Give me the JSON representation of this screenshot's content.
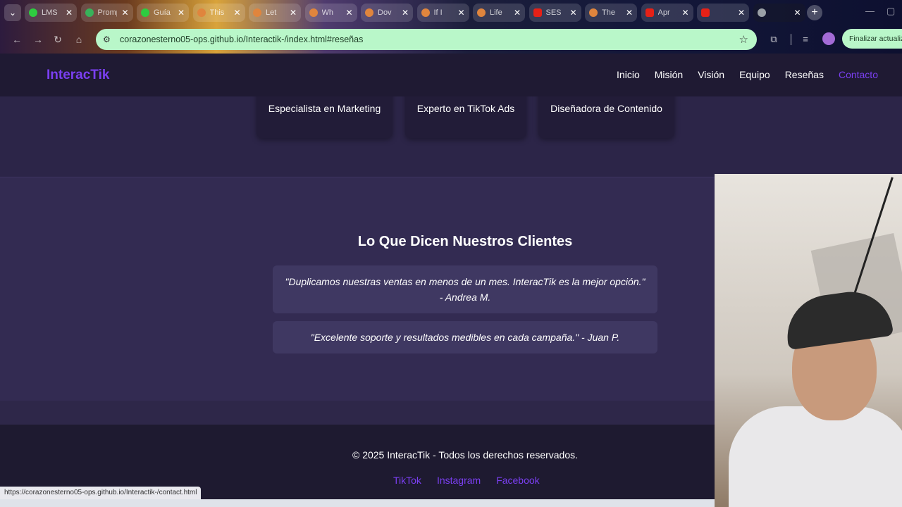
{
  "browser": {
    "tabs": [
      {
        "title": "LMS",
        "fav_color": "#2ecc40"
      },
      {
        "title": "Prompts",
        "fav_color": "#38b25a"
      },
      {
        "title": "Guía",
        "fav_color": "#2ecc40"
      },
      {
        "title": "This",
        "fav_color": "#e0853d"
      },
      {
        "title": "Let",
        "fav_color": "#e0853d"
      },
      {
        "title": "Wh",
        "fav_color": "#e0853d"
      },
      {
        "title": "Dov",
        "fav_color": "#e0853d"
      },
      {
        "title": "If I",
        "fav_color": "#e0853d"
      },
      {
        "title": "Life",
        "fav_color": "#e0853d"
      },
      {
        "title": "SES",
        "fav_color": "#e62117"
      },
      {
        "title": "The",
        "fav_color": "#e0853d"
      },
      {
        "title": "Apr",
        "fav_color": "#e62117"
      },
      {
        "title": "",
        "fav_color": "#e62117"
      },
      {
        "title": "",
        "fav_color": "#9aa0a6"
      }
    ],
    "url": "corazonesterno05-ops.github.io/Interactik-/index.html#reseñas",
    "update_button": "Finalizar actualiz",
    "status_url": "https://corazonesterno05-ops.github.io/Interactik-/contact.html"
  },
  "site": {
    "brand": "InteracTik",
    "nav": [
      "Inicio",
      "Misión",
      "Visión",
      "Equipo",
      "Reseñas",
      "Contacto"
    ],
    "team_roles": [
      "Especialista en Marketing",
      "Experto en TikTok Ads",
      "Diseñadora de Contenido"
    ],
    "reviews_title": "Lo Que Dicen Nuestros Clientes",
    "reviews": [
      "\"Duplicamos nuestras ventas en menos de un mes. InteracTik es la mejor opción.\" - Andrea M.",
      "\"Excelente soporte y resultados medibles en cada campaña.\" - Juan P."
    ],
    "footer_copy": "© 2025 InteracTik - Todos los derechos reservados.",
    "social": [
      "TikTok",
      "Instagram",
      "Facebook"
    ]
  },
  "colors": {
    "accent": "#7b3ff2",
    "omnibox": "#b9f7c9",
    "header_bg": "#1f1a33",
    "reviews_bg": "#332b52"
  }
}
